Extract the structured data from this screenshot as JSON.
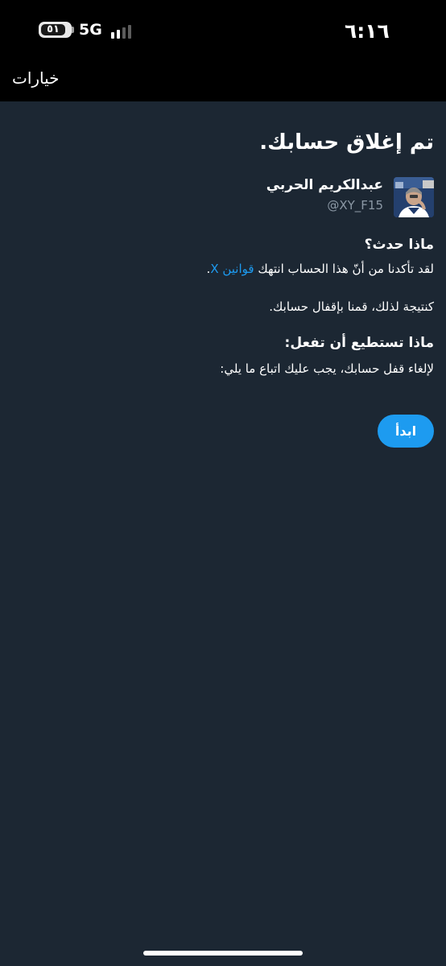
{
  "status_bar": {
    "time": "٦:١٦",
    "battery_level": "٥١",
    "network": "5G",
    "signal_bars_active": 2,
    "signal_bars_total": 4
  },
  "header": {
    "options_label": "خيارات"
  },
  "main": {
    "title": "تم إغلاق حسابك.",
    "profile": {
      "display_name": "عبدالكريم الحربي",
      "handle": "@XY_F15"
    },
    "what_happened": {
      "heading": "ماذا حدث؟",
      "text_before_link": "لقد تأكدنا من أنّ هذا الحساب انتهك ",
      "link_text": "قوانين X",
      "text_after_link": ".",
      "result_text": "كنتيجة لذلك، قمنا بإقفال حسابك."
    },
    "what_you_can_do": {
      "heading": "ماذا تستطيع أن تفعل:",
      "text": "لإلغاء قفل حسابك، يجب عليك اتباع ما يلي:"
    },
    "start_button_label": "ابدأ"
  },
  "colors": {
    "background": "#1c2733",
    "bar_background": "#000000",
    "accent": "#1d9bf0",
    "secondary_text": "#8b98a5"
  }
}
